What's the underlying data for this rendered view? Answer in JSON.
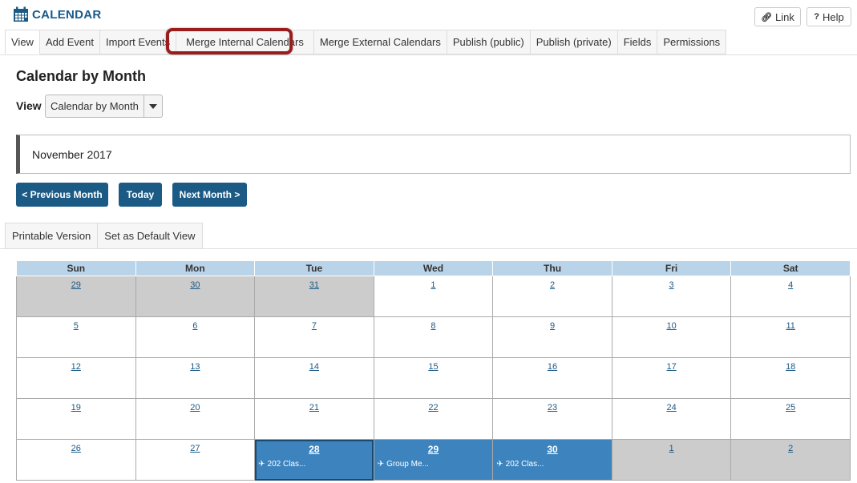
{
  "header": {
    "title": "CALENDAR",
    "link_label": "Link",
    "help_label": "Help"
  },
  "tabs": [
    {
      "label": "View",
      "active": true
    },
    {
      "label": "Add Event"
    },
    {
      "label": "Import Events"
    },
    {
      "label": "Merge Internal Calendars",
      "highlighted": true
    },
    {
      "label": "Merge External Calendars"
    },
    {
      "label": "Publish (public)"
    },
    {
      "label": "Publish (private)"
    },
    {
      "label": "Fields"
    },
    {
      "label": "Permissions"
    }
  ],
  "page_title": "Calendar by Month",
  "view": {
    "label": "View",
    "selected": "Calendar by Month"
  },
  "month_label": "November 2017",
  "nav": {
    "prev": "< Previous Month",
    "today": "Today",
    "next": "Next Month >"
  },
  "sub_tabs": [
    "Printable Version",
    "Set as Default View"
  ],
  "calendar": {
    "weekdays": [
      "Sun",
      "Mon",
      "Tue",
      "Wed",
      "Thu",
      "Fri",
      "Sat"
    ],
    "weeks": [
      [
        {
          "d": "29",
          "other": true
        },
        {
          "d": "30",
          "other": true
        },
        {
          "d": "31",
          "other": true
        },
        {
          "d": "1"
        },
        {
          "d": "2"
        },
        {
          "d": "3"
        },
        {
          "d": "4"
        }
      ],
      [
        {
          "d": "5"
        },
        {
          "d": "6"
        },
        {
          "d": "7"
        },
        {
          "d": "8"
        },
        {
          "d": "9"
        },
        {
          "d": "10"
        },
        {
          "d": "11"
        }
      ],
      [
        {
          "d": "12"
        },
        {
          "d": "13"
        },
        {
          "d": "14"
        },
        {
          "d": "15"
        },
        {
          "d": "16"
        },
        {
          "d": "17"
        },
        {
          "d": "18"
        }
      ],
      [
        {
          "d": "19"
        },
        {
          "d": "20"
        },
        {
          "d": "21"
        },
        {
          "d": "22"
        },
        {
          "d": "23"
        },
        {
          "d": "24"
        },
        {
          "d": "25"
        }
      ],
      [
        {
          "d": "26"
        },
        {
          "d": "27"
        },
        {
          "d": "28",
          "event": "202 Clas...",
          "selected": true
        },
        {
          "d": "29",
          "event": "Group Me..."
        },
        {
          "d": "30",
          "event": "202 Clas..."
        },
        {
          "d": "1",
          "other": true
        },
        {
          "d": "2",
          "other": true
        }
      ]
    ]
  },
  "colors": {
    "brand": "#1b5a85",
    "event_bg": "#3d84bf",
    "header_bg": "#b9d3e8",
    "other_month": "#cccccc",
    "highlight": "#9b1c1c"
  }
}
